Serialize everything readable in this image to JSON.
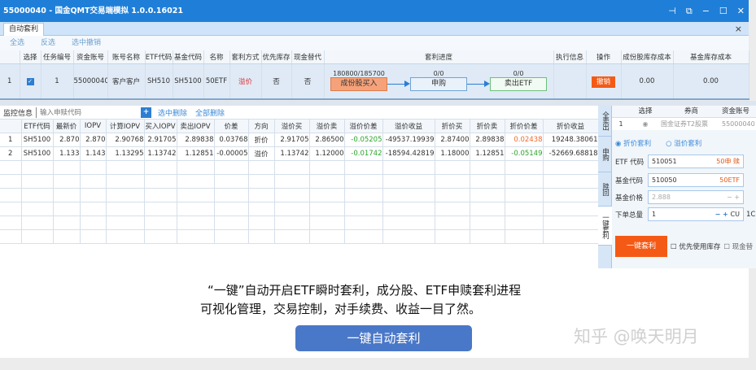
{
  "window": {
    "title": "55000040 - 国金QMT交易端模拟 1.0.0.16021",
    "controls": [
      "⊣",
      "⧉",
      "−",
      "☐",
      "✕"
    ]
  },
  "tab": {
    "label": "自动套利",
    "close": "×"
  },
  "toolbar": {
    "select_all": "全选",
    "invert": "反选",
    "cancel_selected": "选中撤销"
  },
  "task_table": {
    "headers": [
      "",
      "选择",
      "任务编号",
      "资金账号",
      "账号名称",
      "ETF代码",
      "基金代码",
      "名称",
      "套利方式",
      "优先库存",
      "现金替代",
      "套利进度",
      "执行信息",
      "操作",
      "成份股库存成本",
      "基金库存成本"
    ],
    "row": {
      "index": "1",
      "checked": true,
      "task_id": "1",
      "account": "55000040",
      "account_name": "客户客户",
      "etf_code": "SH510",
      "fund_code": "SH5100",
      "name": "50ETF",
      "method": "溢价",
      "priority_stock": "否",
      "cash_sub": "否",
      "exec_info": "",
      "action": "撤销",
      "stock_cost": "0.00",
      "fund_cost": "0.00",
      "progress": [
        {
          "count": "180800/185700",
          "label": "成份股买入"
        },
        {
          "count": "0/0",
          "label": "申购"
        },
        {
          "count": "0/0",
          "label": "卖出ETF"
        }
      ]
    }
  },
  "monitor": {
    "label": "监控信息",
    "search_placeholder": "输入申赎代码",
    "add": "+",
    "delete_selected": "选中删除",
    "delete_all": "全部删除",
    "headers": [
      "",
      "ETF代码",
      "最新价",
      "IOPV",
      "计算IOPV",
      "买入IOPV",
      "卖出IOPV",
      "价差",
      "方向",
      "溢价买",
      "溢价卖",
      "溢价价差",
      "溢价收益",
      "折价买",
      "折价卖",
      "折价价差",
      "折价收益"
    ],
    "rows": [
      [
        "1",
        "SH5100",
        "2.870",
        "2.870",
        "2.90768",
        "2.91705",
        "2.89838",
        "0.03768",
        "折价",
        "2.91705",
        "2.86500",
        "-0.05205",
        "-49537.19939",
        "2.87400",
        "2.89838",
        "0.02438",
        "19248.38061"
      ],
      [
        "2",
        "SH5100",
        "1.133",
        "1.143",
        "1.13295",
        "1.13742",
        "1.12851",
        "-0.00005",
        "溢价",
        "1.13742",
        "1.12000",
        "-0.01742",
        "-18594.42819",
        "1.18000",
        "1.12851",
        "-0.05149",
        "-52669.68818"
      ]
    ]
  },
  "side_tabs": [
    "全卖出",
    "申购",
    "赎回",
    "一键套利"
  ],
  "right_panel": {
    "headers": [
      "选择",
      "券商",
      "资金账号"
    ],
    "row": {
      "index": "1",
      "broker": "国金证券T2股票",
      "account": "55000040"
    },
    "mode_discount": "折价套利",
    "mode_premium": "溢价套利",
    "etf_label": "ETF 代码",
    "etf_value": "510051",
    "etf_hint": "50申 赎",
    "fund_label": "基金代码",
    "fund_value": "510050",
    "fund_hint": "50ETF",
    "price_label": "基金价格",
    "price_value": "2.888",
    "qty_label": "下单总量",
    "qty_value": "1",
    "qty_unit": "CU",
    "qty_extra": "1C",
    "go": "一键套利",
    "use_stock": "优先使用库存",
    "cash": "现金替"
  },
  "caption": {
    "line1": "“一键”自动开启ETF瞬时套利，成分股、ETF申赎套利进程",
    "line2": "可视化管理，交易控制，对手续费、收益一目了然。",
    "button": "一键自动套利",
    "watermark": "知乎 @唤天明月"
  }
}
